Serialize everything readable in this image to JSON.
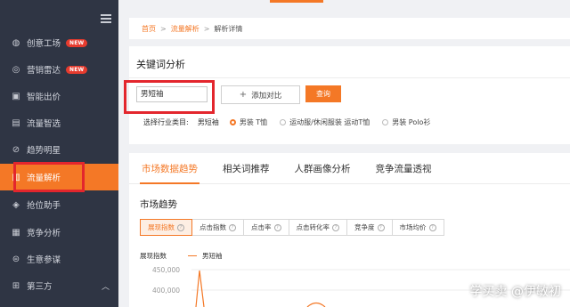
{
  "sidebar": {
    "items": [
      {
        "label": "创意工场",
        "icon": "bulb-icon",
        "badge": "NEW"
      },
      {
        "label": "营销雷达",
        "icon": "radar-icon",
        "badge": "NEW"
      },
      {
        "label": "智能出价",
        "icon": "bid-icon"
      },
      {
        "label": "流量智选",
        "icon": "filter-icon"
      },
      {
        "label": "趋势明星",
        "icon": "star-icon"
      },
      {
        "label": "流量解析",
        "icon": "chart-icon"
      },
      {
        "label": "抢位助手",
        "icon": "target-icon"
      },
      {
        "label": "竞争分析",
        "icon": "compare-icon"
      },
      {
        "label": "生意参谋",
        "icon": "briefcase-icon"
      },
      {
        "label": "第三方",
        "icon": "apps-icon"
      }
    ]
  },
  "breadcrumb": {
    "home": "首页",
    "section": "流量解析",
    "current": "解析详情",
    "sep": ">"
  },
  "keyword_panel": {
    "title": "关键词分析",
    "input_value": "男短袖",
    "add_compare_label": "添加对比",
    "query_label": "查询",
    "category_label": "选择行业类目:",
    "category_keyword": "男短袖",
    "options": [
      "男装 T恤",
      "运动服/休闲服装 运动T恤",
      "男装 Polo衫"
    ],
    "selected_option": 0
  },
  "tabs": [
    "市场数据趋势",
    "相关词推荐",
    "人群画像分析",
    "竞争流量透视"
  ],
  "active_tab": 0,
  "trend": {
    "title": "市场趋势",
    "metrics": [
      "展现指数",
      "点击指数",
      "点击率",
      "点击转化率",
      "竞争度",
      "市场均价"
    ],
    "active_metric": 0,
    "chart_label": "展现指数",
    "legend": "男短袖",
    "y_ticks": [
      "450,000",
      "400,000"
    ]
  },
  "watermark": "学买卖 @伊敏初",
  "colors": {
    "accent": "#f47826",
    "sidebar": "#2f3544",
    "highlight": "#e3262d"
  }
}
